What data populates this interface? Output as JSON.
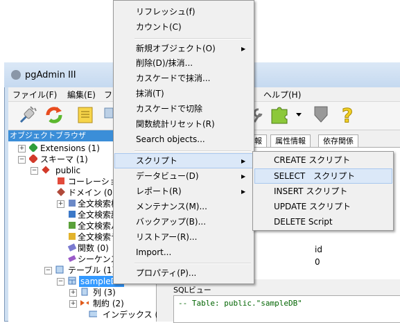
{
  "window": {
    "title": "pgAdmin III"
  },
  "menubar": {
    "items": [
      "ファイル(F)",
      "編集(E)",
      "フ",
      "ヘルプ(H)"
    ]
  },
  "browser": {
    "header": "オブジェクトブラウザ",
    "tree": [
      {
        "label": "Extensions (1)"
      },
      {
        "label": "スキーマ (1)"
      },
      {
        "label": "public"
      },
      {
        "label": "コーレーション"
      },
      {
        "label": "ドメイン (0)"
      },
      {
        "label": "全文検索構"
      },
      {
        "label": "全文検索辞"
      },
      {
        "label": "全文検索パ"
      },
      {
        "label": "全文検索テン"
      },
      {
        "label": "関数 (0)"
      },
      {
        "label": "シーケンス (0"
      },
      {
        "label": "テーブル (1)"
      },
      {
        "label": "sampleDB"
      },
      {
        "label": "列 (3)"
      },
      {
        "label": "制約 (2)"
      },
      {
        "label": "インデックス (0)"
      }
    ]
  },
  "tabs": [
    "報",
    "属性情報",
    "依存関係"
  ],
  "properties": {
    "value1": "id",
    "value2": "0"
  },
  "sql": {
    "header": "SQLビュー",
    "line1": "-- Table: public.\"sampleDB\""
  },
  "context_menu": {
    "items": [
      "リフレッシュ(f)",
      "カウント(C)",
      "新規オブジェクト(O)",
      "削除(D)/抹消...",
      "カスケードで抹消...",
      "抹消(T)",
      "カスケードで切除",
      "関数統計リセット(R)",
      "Search objects...",
      "スクリプト",
      "データビュー(D)",
      "レポート(R)",
      "メンテナンス(M)...",
      "バックアップ(B)...",
      "リストアー(R)...",
      "Import...",
      "プロパティ(P)..."
    ]
  },
  "submenu": {
    "items": [
      "CREATE スクリプト",
      "SELECT　スクリプト",
      "INSERT スクリプト",
      "UPDATE スクリプト",
      "DELETE Script"
    ]
  }
}
